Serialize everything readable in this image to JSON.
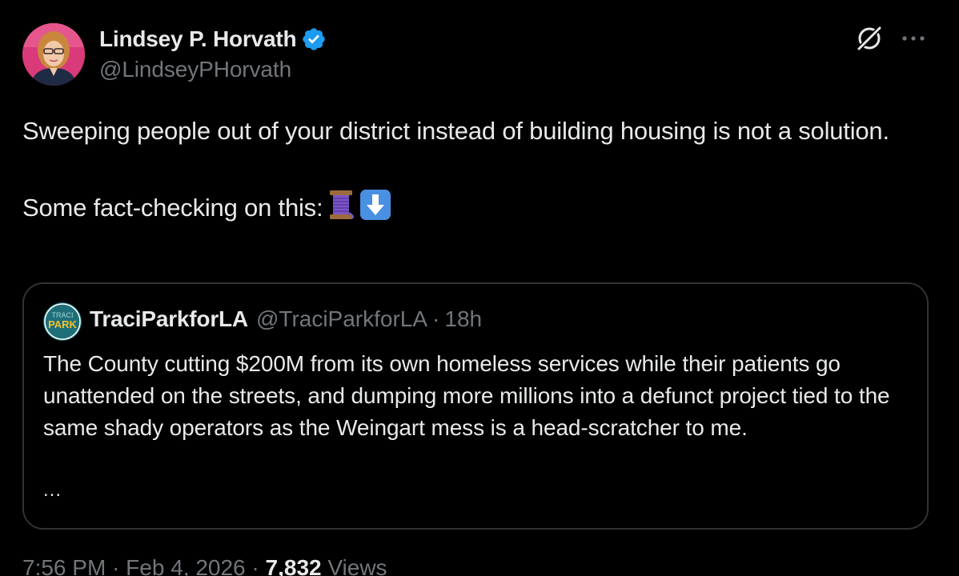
{
  "author": {
    "display_name": "Lindsey P. Horvath",
    "handle": "@LindseyPHorvath",
    "verified": true
  },
  "tweet": {
    "line1": "Sweeping people out of your district instead of building housing is not a solution.",
    "line2": "Some fact-checking on this:",
    "emojis": [
      "thread-spool-icon",
      "down-arrow-icon"
    ]
  },
  "quote": {
    "display_name": "TraciParkforLA",
    "handle": "@TraciParkforLA",
    "separator": "·",
    "time": "18h",
    "avatar_text_top": "TRACI",
    "avatar_text_bottom": "PARK",
    "text": "The County cutting $200M from its own homeless services while their patients go unattended on the streets, and dumping more millions into a defunct project tied to the same shady operators as the Weingart mess is a head-scratcher to me.",
    "ellipsis": "..."
  },
  "meta": {
    "time": "7:56 PM",
    "date": "Feb 4, 2026",
    "separator": "·",
    "views_count": "7,832",
    "views_label": "Views"
  },
  "colors": {
    "background": "#000000",
    "text_primary": "#e7e9ea",
    "text_secondary": "#71767b",
    "border": "#2f3336",
    "verified_blue": "#1d9bf0"
  }
}
